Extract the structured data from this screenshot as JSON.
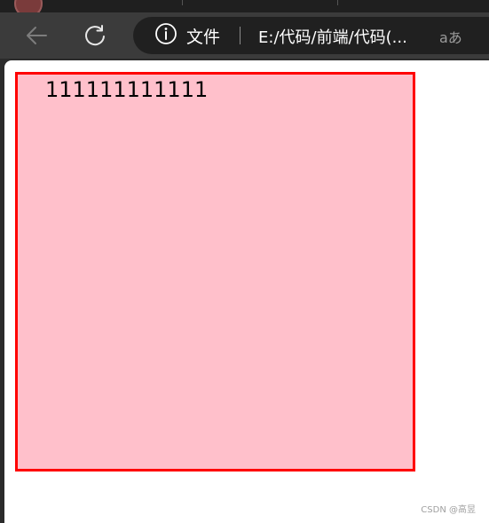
{
  "browser": {
    "address_bar": {
      "site_info_label": "文件",
      "url": "E:/代码/前端/代码(...",
      "read_aloud_label": "aあ"
    }
  },
  "page": {
    "box": {
      "text": "111111111111",
      "background_color": "#ffc0cb",
      "border_color": "#ff0000"
    }
  },
  "watermark": "CSDN @高昱",
  "icons": {
    "back": "back-arrow-icon",
    "refresh": "refresh-icon",
    "info": "info-icon",
    "read_aloud": "read-aloud-icon"
  }
}
